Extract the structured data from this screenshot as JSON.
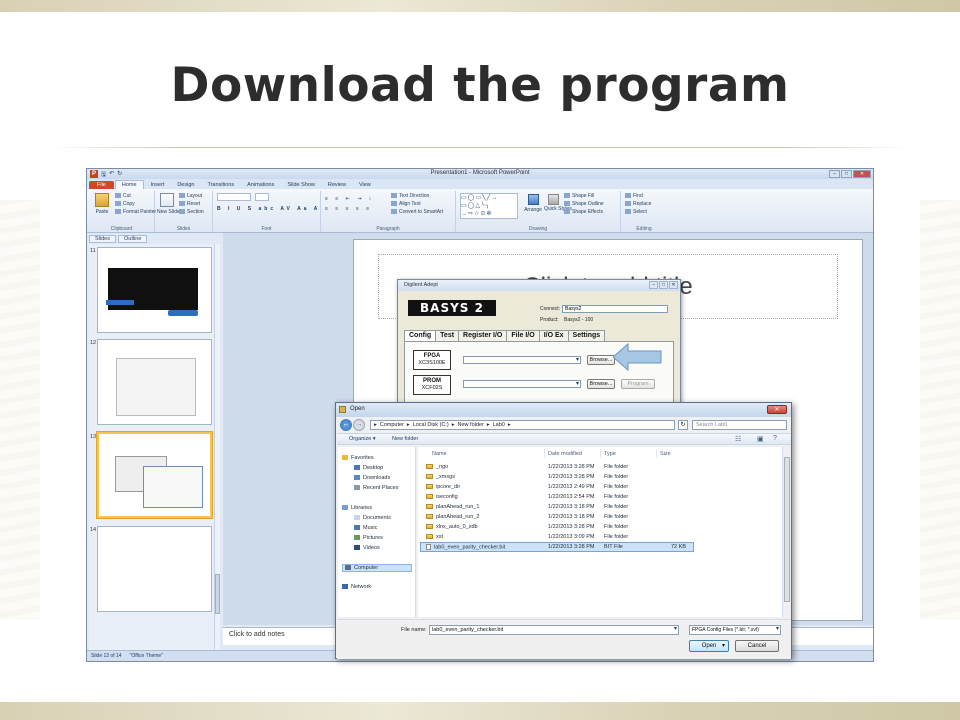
{
  "slide": {
    "title": "Download the program"
  },
  "ppt": {
    "window_title": "Presentation1 - Microsoft PowerPoint",
    "tabs": [
      "File",
      "Home",
      "Insert",
      "Design",
      "Transitions",
      "Animations",
      "Slide Show",
      "Review",
      "View"
    ],
    "ribbon": {
      "clipboard": {
        "paste": "Paste",
        "cut": "Cut",
        "copy": "Copy",
        "format_painter": "Format Painter",
        "name": "Clipboard"
      },
      "slides": {
        "new_slide": "New Slide",
        "layout": "Layout",
        "reset": "Reset",
        "section": "Section",
        "name": "Slides"
      },
      "font": {
        "name": "Font"
      },
      "paragraph": {
        "text_direction": "Text Direction",
        "align_text": "Align Text",
        "convert": "Convert to SmartArt",
        "name": "Paragraph"
      },
      "drawing": {
        "arrange": "Arrange",
        "quick_styles": "Quick Styles",
        "shape_fill": "Shape Fill",
        "shape_outline": "Shape Outline",
        "shape_effects": "Shape Effects",
        "name": "Drawing"
      },
      "editing": {
        "find": "Find",
        "replace": "Replace",
        "select": "Select",
        "name": "Editing"
      }
    },
    "panel_tabs": [
      "Slides",
      "Outline"
    ],
    "thumbnails": [
      "11",
      "12",
      "13",
      "14"
    ],
    "slide_placeholder": "Click to add title",
    "notes_placeholder": "Click to add notes",
    "status": {
      "slide_count": "Slide 13 of 14",
      "theme": "\"Office Theme\""
    }
  },
  "adept": {
    "title": "Digilent Adept",
    "logo": "BASYS 2",
    "connect_label": "Connect:",
    "connect_value": "Basys2",
    "product_label": "Product:",
    "product_value": "Basys2 - 100",
    "tabs": [
      "Config",
      "Test",
      "Register I/O",
      "File I/O",
      "I/O Ex",
      "Settings"
    ],
    "devices": [
      {
        "name": "FPGA",
        "part": "XC3S100E"
      },
      {
        "name": "PROM",
        "part": "XCF02S"
      }
    ],
    "browse_label": "Browse...",
    "program_label": "Program"
  },
  "open_dialog": {
    "title": "Open",
    "breadcrumb": [
      "Computer",
      "Local Disk (C:)",
      "New folder",
      "Lab0"
    ],
    "search_placeholder": "Search Lab0",
    "toolbar": {
      "organize": "Organize ▾",
      "new_folder": "New folder"
    },
    "nav": {
      "favorites": "Favorites",
      "desktop": "Desktop",
      "downloads": "Downloads",
      "recent": "Recent Places",
      "libraries": "Libraries",
      "documents": "Documents",
      "music": "Music",
      "pictures": "Pictures",
      "videos": "Videos",
      "computer": "Computer",
      "network": "Network"
    },
    "columns": {
      "name": "Name",
      "date": "Date modified",
      "type": "Type",
      "size": "Size"
    },
    "files": [
      {
        "name": "_ngo",
        "date": "1/22/2013 3:28 PM",
        "type": "File folder",
        "size": ""
      },
      {
        "name": "_xmsgs",
        "date": "1/22/2013 3:28 PM",
        "type": "File folder",
        "size": ""
      },
      {
        "name": "ipcore_dir",
        "date": "1/22/2013 2:49 PM",
        "type": "File folder",
        "size": ""
      },
      {
        "name": "iseconfig",
        "date": "1/22/2013 2:54 PM",
        "type": "File folder",
        "size": ""
      },
      {
        "name": "planAhead_run_1",
        "date": "1/22/2013 3:18 PM",
        "type": "File folder",
        "size": ""
      },
      {
        "name": "planAhead_run_2",
        "date": "1/22/2013 3:18 PM",
        "type": "File folder",
        "size": ""
      },
      {
        "name": "xlnx_auto_0_xdb",
        "date": "1/22/2013 3:28 PM",
        "type": "File folder",
        "size": ""
      },
      {
        "name": "xst",
        "date": "1/22/2013 3:09 PM",
        "type": "File folder",
        "size": ""
      },
      {
        "name": "lab0_even_parity_checker.bit",
        "date": "1/22/2013 3:28 PM",
        "type": "BIT File",
        "size": "72 KB"
      }
    ],
    "filename_label": "File name:",
    "filename_value": "lab0_even_parity_checker.bit",
    "filetype_value": "FPGA Config Files (*.bit; *.svf)",
    "open_label": "Open",
    "cancel_label": "Cancel"
  },
  "colors": {
    "ppt_file_tab": "#d24726",
    "selection": "#cce2f8",
    "band": "#d7d1b4"
  }
}
